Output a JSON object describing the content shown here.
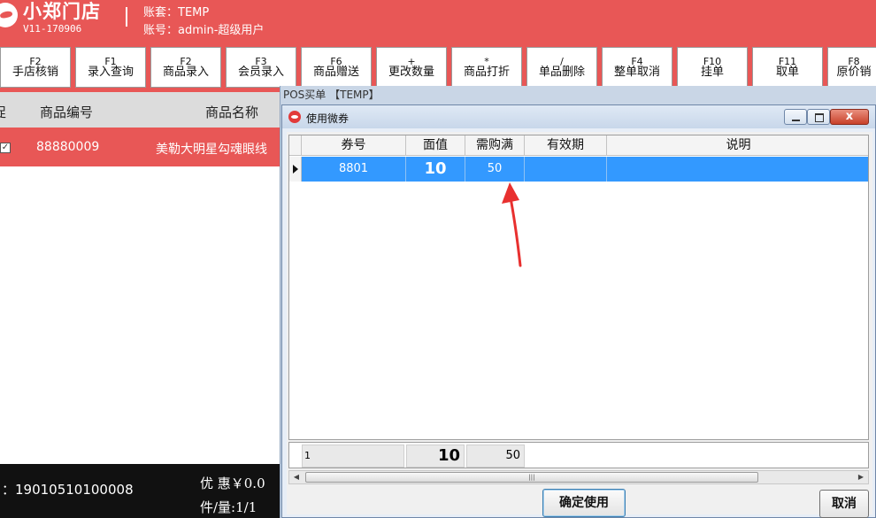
{
  "header": {
    "store_name": "小郑门店",
    "version": "V11-170906",
    "account_set": "账套：TEMP",
    "user": "账号：admin-超级用户"
  },
  "toolbar": {
    "buttons": [
      {
        "key": "F2",
        "label": "手店核销"
      },
      {
        "key": "F1",
        "label": "录入查询"
      },
      {
        "key": "F2",
        "label": "商品录入"
      },
      {
        "key": "F3",
        "label": "会员录入"
      },
      {
        "key": "F6",
        "label": "商品赠送"
      },
      {
        "key": "+",
        "label": "更改数量"
      },
      {
        "key": "*",
        "label": "商品打折"
      },
      {
        "key": "/",
        "label": "单品删除"
      },
      {
        "key": "F4",
        "label": "整单取消"
      },
      {
        "key": "F10",
        "label": "挂单"
      },
      {
        "key": "F11",
        "label": "取单"
      },
      {
        "key": "F8",
        "label": "原价销"
      }
    ]
  },
  "list": {
    "columns": {
      "promo": "促",
      "code": "商品编号",
      "name": "商品名称"
    },
    "rows": [
      {
        "checked": "✓",
        "code": "88880009",
        "name": "美勒大明星勾魂眼线"
      }
    ]
  },
  "bottom": {
    "order_no": "：19010510100008",
    "discount": "优 惠￥0.0",
    "count": "件/量:1/1"
  },
  "pos_window": {
    "title": "POS买单 【TEMP】"
  },
  "dialog": {
    "title": "使用微券",
    "columns": {
      "coupon_no": "券号",
      "face_value": "面值",
      "min_purchase": "需购满",
      "validity": "有效期",
      "description": "说明"
    },
    "rows": [
      {
        "coupon_no": "8801",
        "face_value": "10",
        "min_purchase": "50",
        "validity": "",
        "description": ""
      }
    ],
    "totals": {
      "count": "1",
      "face_value": "10",
      "min_purchase": "50"
    },
    "scroll_grip": "|||",
    "confirm_label": "确定使用",
    "cancel_label": "取消",
    "window_controls": {
      "close_glyph": "x"
    }
  },
  "colors": {
    "brand": "#e85756",
    "selection": "#3399ff",
    "annotation": "#e8302f"
  },
  "icons": [
    "logo-icon",
    "dialog-app-icon",
    "minimize-icon",
    "maximize-icon",
    "close-icon",
    "row-indicator-icon",
    "scroll-left-icon",
    "scroll-right-icon",
    "annotation-arrow-icon"
  ]
}
